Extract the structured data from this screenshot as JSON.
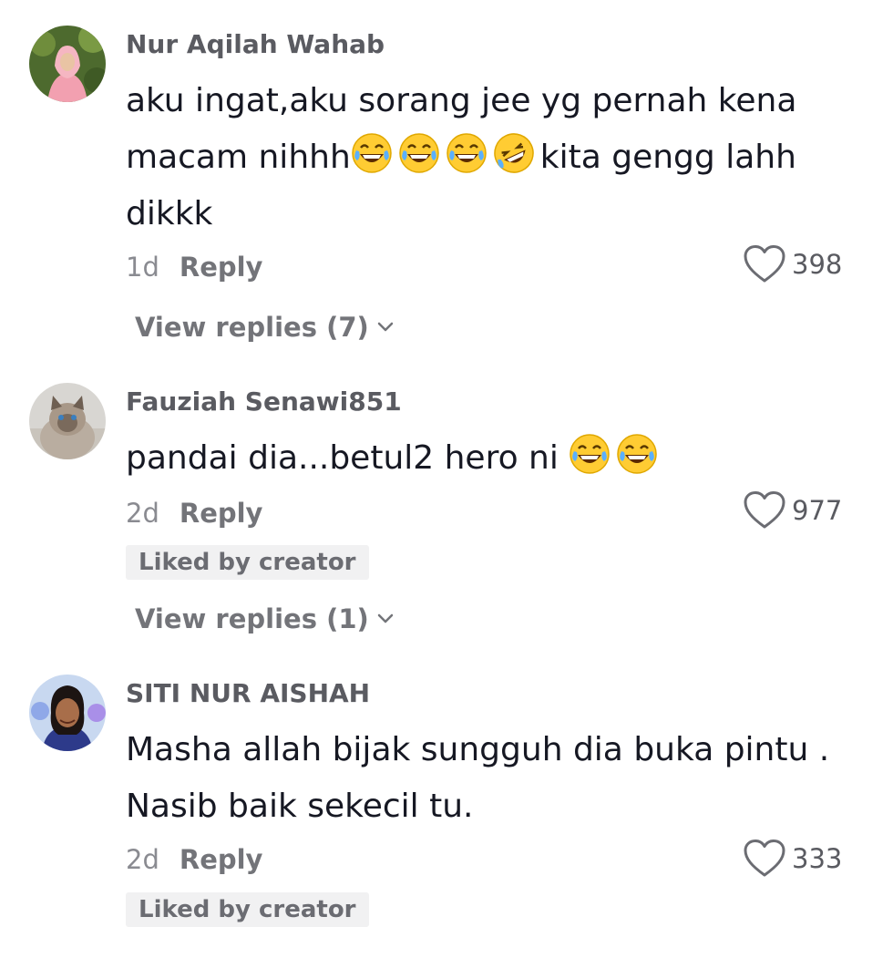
{
  "comments": [
    {
      "username": "Nur Aqilah Wahab",
      "text_parts": [
        "aku ingat,aku sorang jee yg pernah kena macam nihhh",
        "kita gengg lahh dikkk"
      ],
      "emojis": [
        "face-with-tears-of-joy-emoji",
        "face-with-tears-of-joy-emoji",
        "face-with-tears-of-joy-emoji",
        "rolling-on-floor-laughing-emoji"
      ],
      "time": "1d",
      "reply_label": "Reply",
      "likes": "398",
      "view_replies": "View replies (7)"
    },
    {
      "username": "Fauziah Senawi851",
      "text_parts": [
        "pandai dia...betul2 hero ni "
      ],
      "emojis": [
        "face-with-tears-of-joy-emoji",
        "face-with-tears-of-joy-emoji"
      ],
      "time": "2d",
      "reply_label": "Reply",
      "likes": "977",
      "liked_by_creator": "Liked by creator",
      "view_replies": "View replies (1)"
    },
    {
      "username": "SITI NUR AISHAH",
      "text_parts": [
        "Masha allah bijak sungguh dia buka pintu . Nasib baik sekecil tu."
      ],
      "time": "2d",
      "reply_label": "Reply",
      "likes": "333",
      "liked_by_creator": "Liked by creator"
    }
  ],
  "icons": {
    "like": "heart-outline-icon",
    "expand": "chevron-down-icon"
  },
  "colors": {
    "text_primary": "#161823",
    "text_secondary": "#737479",
    "badge_bg": "#f1f1f2",
    "emoji_yellow": "#ffcc33"
  }
}
